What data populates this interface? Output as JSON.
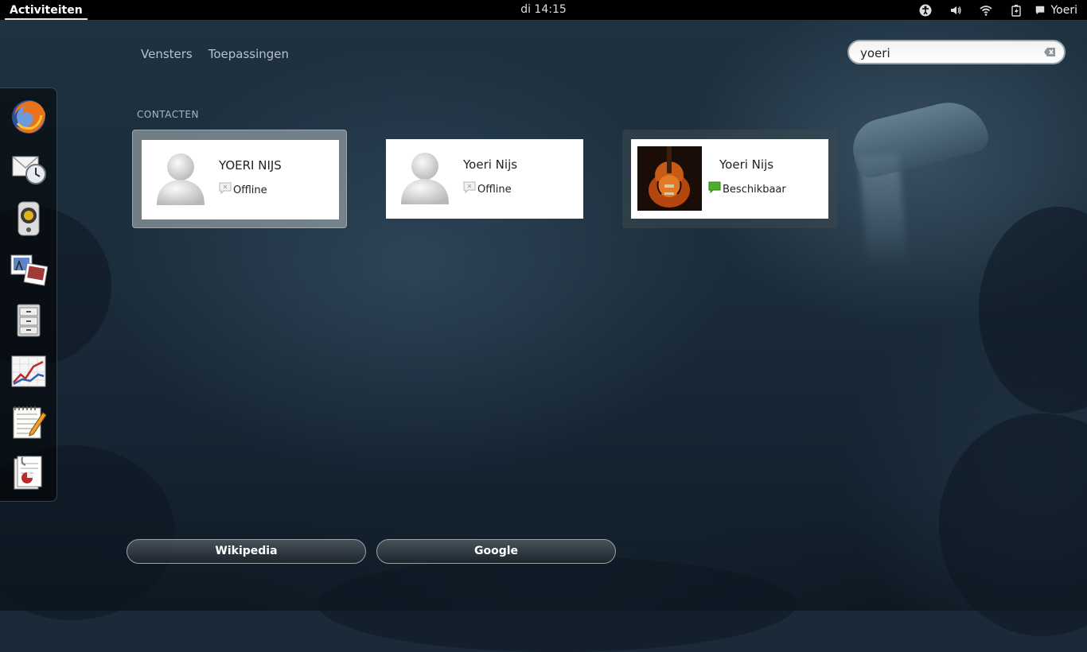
{
  "topbar": {
    "activities_label": "Activiteiten",
    "clock": "di 14:15",
    "user_name": "Yoeri"
  },
  "view_tabs": [
    {
      "label": "Vensters"
    },
    {
      "label": "Toepassingen"
    }
  ],
  "search": {
    "value": "yoeri"
  },
  "dash": {
    "items": [
      {
        "icon": "firefox-icon"
      },
      {
        "icon": "evolution-mail-icon"
      },
      {
        "icon": "rhythmbox-speaker-icon"
      },
      {
        "icon": "shotwell-photos-icon"
      },
      {
        "icon": "file-manager-cabinet-icon"
      },
      {
        "icon": "system-monitor-chart-icon"
      },
      {
        "icon": "text-editor-icon"
      },
      {
        "icon": "document-viewer-icon"
      }
    ]
  },
  "results": {
    "section_title": "CONTACTEN",
    "contacts": [
      {
        "name": "YOERI NIJS",
        "status": "Offline",
        "status_color": "#cccccc"
      },
      {
        "name": "Yoeri Nijs",
        "status": "Offline",
        "status_color": "#cccccc"
      },
      {
        "name": "Yoeri Nijs",
        "status": "Beschikbaar",
        "status_color": "#4caf2a"
      }
    ]
  },
  "search_providers": [
    {
      "label": "Wikipedia"
    },
    {
      "label": "Google"
    }
  ]
}
